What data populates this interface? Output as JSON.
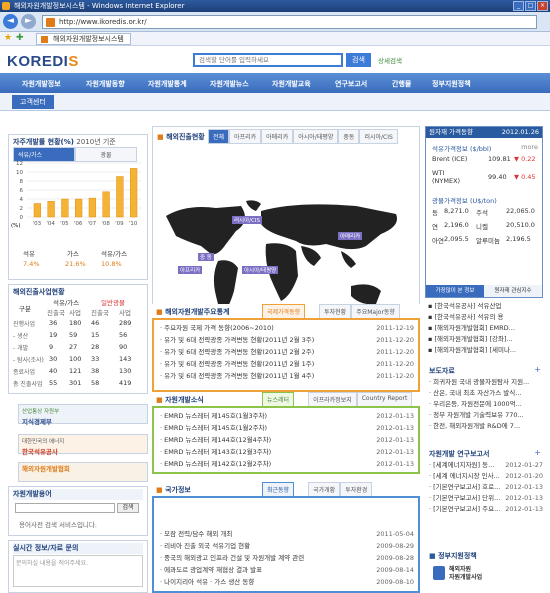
{
  "browser": {
    "title": "해외자원개발정보시스템 - Windows Internet Explorer",
    "url": "http://www.ikoredis.or.kr/",
    "tab": "해외자원개발정보시스템"
  },
  "header": {
    "logo_main": "KOREDI",
    "logo_accent": "S",
    "search_placeholder": "검색할 단어를 입력하세요",
    "search_button": "검색",
    "search_link": "상세검색"
  },
  "gnav": [
    "자원개발정보",
    "자원개발동향",
    "자원개발통계",
    "자원개발뉴스",
    "자원개발교육",
    "연구보고서",
    "간행물",
    "정부지원정책"
  ],
  "snav": {
    "selected": "고객센터"
  },
  "stats": {
    "title": "자주개발률 현황(%)",
    "year": "2010년 기준",
    "tab1": "석유/가스",
    "tab2": "광물",
    "yaxis": [
      "12",
      "10",
      "8",
      "6",
      "4",
      "2",
      "0"
    ],
    "ylabel": "(%)",
    "xlabels": [
      "'03",
      "'04",
      "'05",
      "'06",
      "'07",
      "'08",
      "'09",
      "'10"
    ],
    "foot_labels": [
      "석유",
      "가스",
      "석유/가스"
    ],
    "foot_values": [
      "7.4%",
      "21.6%",
      "10.8%"
    ]
  },
  "chart_data": {
    "type": "bar",
    "title": "자주개발률 현황(%)",
    "categories": [
      "'03",
      "'04",
      "'05",
      "'06",
      "'07",
      "'08",
      "'09",
      "'10"
    ],
    "values": [
      3.0,
      3.5,
      4.0,
      4.0,
      4.2,
      5.6,
      9.0,
      10.8
    ],
    "ylim": [
      0,
      12
    ]
  },
  "projects": {
    "title": "해외진출사업현황",
    "cols": [
      "구분",
      "석유/가스",
      "일반광물"
    ],
    "sub": [
      "진출국",
      "사업",
      "진출국",
      "사업"
    ],
    "rows": [
      [
        "진행사업",
        "36",
        "180",
        "46",
        "289"
      ],
      [
        "- 생산",
        "19",
        "59",
        "15",
        "56"
      ],
      [
        "- 개발",
        "9",
        "27",
        "28",
        "90"
      ],
      [
        "- 탐사(조사)",
        "30",
        "100",
        "33",
        "143"
      ],
      [
        "종료사업",
        "40",
        "121",
        "38",
        "130"
      ],
      [
        "총 진출사업",
        "55",
        "301",
        "58",
        "419"
      ]
    ]
  },
  "banners": [
    "지식경제부",
    "한국석유공사",
    "해외자원개발협회"
  ],
  "banner_top": [
    "산업통상 자원부",
    "대한민국의 에너지"
  ],
  "faq": {
    "title": "자원개발용어",
    "btn": "검색",
    "text": "용어사전 검색 서비스입니다."
  },
  "qna": {
    "title": "실시간 정보/자료 문의",
    "placeholder": "문의하실 내용을 적어주세요."
  },
  "map": {
    "title": "해외진출현황",
    "tabs": [
      "전체",
      "아프리카",
      "아메리카",
      "아시아/태평양",
      "중동",
      "러시아/CIS"
    ],
    "labels": [
      "러시아/CIS",
      "아메리카",
      "중 동",
      "아프리카",
      "아시아/태평양"
    ]
  },
  "policy": {
    "title": "해외자원개발주요통계",
    "tabs": [
      "국제가격동향",
      "투자현황",
      "주요Major동향"
    ],
    "items": [
      [
        "주요자원 국제 가격 동향(2006~2010)",
        "2011-12-19"
      ],
      [
        "유가 및 6대 전략광종 가격변동 현황(2011년 2월 3주)",
        "2011-12-20"
      ],
      [
        "유가 및 6대 전략광종 가격변동 현황(2011년 2월 2주)",
        "2011-12-20"
      ],
      [
        "유가 및 6대 전략광종 가격변동 현황(2011년 2월 1주)",
        "2011-12-20"
      ],
      [
        "유가 및 6대 전략광종 가격변동 현황(2011년 1월 4주)",
        "2011-12-20"
      ]
    ]
  },
  "newsletter": {
    "title": "자원개발소식",
    "tabs": [
      "뉴스레터",
      "이프라카정보지",
      "Country Report"
    ],
    "items": [
      [
        "EMRD 뉴스레터 제145호(1월3주차)",
        "2012-01-13"
      ],
      [
        "EMRD 뉴스레터 제145호(1월2주차)",
        "2012-01-13"
      ],
      [
        "EMRD 뉴스레터 제144호(12월4주차)",
        "2012-01-13"
      ],
      [
        "EMRD 뉴스레터 제143호(12월3주차)",
        "2012-01-13"
      ],
      [
        "EMRD 뉴스레터 제142호(12월2주차)",
        "2012-01-13"
      ]
    ]
  },
  "country": {
    "title": "국가정보",
    "tabs": [
      "최근동향",
      "국가개황",
      "투자환경"
    ],
    "items": [
      [
        "모잠 전력/담수 해외 개최",
        "2011-05-04"
      ],
      [
        "리비아 진출 외국 석유기업 현황",
        "2009-08-29"
      ],
      [
        "중국의 해외광고 인프라 건설 및 자원개발 계약 관련",
        "2009-08-28"
      ],
      [
        "에콰도르 광업계약 재협상 결과 발표",
        "2009-08-14"
      ],
      [
        "나이지리아 석유 · 가스 생산 동향",
        "2009-08-10"
      ]
    ]
  },
  "prices": {
    "title": "원자재 가격동향",
    "date": "2012.01.26",
    "oil_title": "석유가격정보 ($/bbl)",
    "more": "more",
    "oil": [
      [
        "Brent (ICE)",
        "109.81",
        "0.22"
      ],
      [
        "WTI (NYMEX)",
        "99.40",
        "0.45"
      ]
    ],
    "metal_title": "광물가격정보 (U$/ton)",
    "metals": [
      [
        "동",
        "8,271.0",
        "주석",
        "22,065.0"
      ],
      [
        "연",
        "2,196.0",
        "니켈",
        "20,510.0"
      ],
      [
        "아연",
        "2,095.5",
        "알루미늄",
        "2,196.5"
      ]
    ],
    "tabs": [
      "가장많이 본 정보",
      "원자재 관심지수"
    ]
  },
  "popular": [
    "[한국석유공사] 석유산업",
    "[한국석유공사] 석유의 용",
    "[해외자원개발협회] EMRD...",
    "[해외자원개발협회] [강좌]...",
    "[해외자원개발협회] [세미나..."
  ],
  "reports": {
    "title": "보도자료",
    "items": [
      "희귀자원 국내 광물자원탐사 지원...",
      "산은, 국내 최초 자산가스 발식...",
      "우리은등, 자원전문에 1000억...",
      "정부 자원개발 기술력보유 770...",
      "한전, 해외자원개발 R&D에 7..."
    ]
  },
  "research": {
    "title": "자원개발 연구보고서",
    "items": [
      [
        "[세계에너지자원] 동...",
        "2012-01-27"
      ],
      [
        "[세계 에너지시장 인사...",
        "2012-01-20"
      ],
      [
        "[기본연구보고서] 호로...",
        "2012-01-13"
      ],
      [
        "[기본연구보고서] 단위...",
        "2012-01-13"
      ],
      [
        "[기본연구보고서] 주요...",
        "2012-01-13"
      ]
    ]
  },
  "gov": {
    "title": "정부지원정책",
    "text": "해외자원\n자원개발사업"
  }
}
